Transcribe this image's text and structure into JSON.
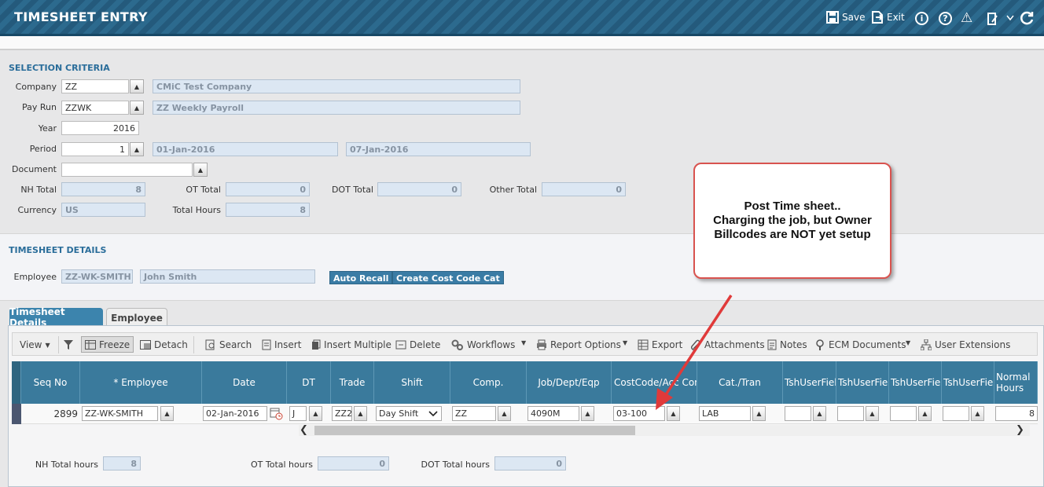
{
  "header": {
    "title": "TIMESHEET ENTRY",
    "save_label": "Save",
    "exit_label": "Exit",
    "info_icon": "i",
    "help_icon": "?",
    "warn_icon": "⚠"
  },
  "selection": {
    "title": "SELECTION CRITERIA",
    "company_label": "Company",
    "company_value": "ZZ",
    "company_name": "CMiC Test Company",
    "payrun_label": "Pay Run",
    "payrun_value": "ZZWK",
    "payrun_name": "ZZ Weekly Payroll",
    "year_label": "Year",
    "year_value": "2016",
    "period_label": "Period",
    "period_value": "1",
    "period_start": "01-Jan-2016",
    "period_end": "07-Jan-2016",
    "document_label": "Document",
    "document_value": "",
    "nh_total_label": "NH Total",
    "nh_total_value": "8",
    "ot_total_label": "OT Total",
    "ot_total_value": "0",
    "dot_total_label": "DOT Total",
    "dot_total_value": "0",
    "other_total_label": "Other Total",
    "other_total_value": "0",
    "currency_label": "Currency",
    "currency_value": "US",
    "total_hours_label": "Total Hours",
    "total_hours_value": "8"
  },
  "details": {
    "title": "TIMESHEET DETAILS",
    "employee_label": "Employee",
    "employee_code": "ZZ-WK-SMITH",
    "employee_name": "John Smith",
    "auto_recall_label": "Auto Recall",
    "create_cost_code_label": "Create Cost Code Cat"
  },
  "tabs": {
    "timesheet_details": "Timesheet Details",
    "employee": "Employee"
  },
  "toolbar": {
    "view": "View",
    "freeze": "Freeze",
    "detach": "Detach",
    "search": "Search",
    "insert": "Insert",
    "insert_multiple": "Insert Multiple",
    "delete": "Delete",
    "workflows": "Workflows",
    "report_options": "Report Options",
    "export": "Export",
    "attachments": "Attachments",
    "notes": "Notes",
    "ecm_documents": "ECM Documents",
    "user_extensions": "User Extensions"
  },
  "grid": {
    "headers": {
      "seq_no": "Seq No",
      "employee": "* Employee",
      "date": "Date",
      "dt": "DT",
      "trade": "Trade",
      "shift": "Shift",
      "comp": "Comp.",
      "job": "Job/Dept/Eqp",
      "costcode": "CostCode/Acc Comp",
      "cat": "Cat./Tran",
      "uf1": "TshUserField",
      "uf2": "TshUserField",
      "uf3": "TshUserField",
      "uf4": "TshUserField",
      "normal_hours": "Normal Hours"
    },
    "row": {
      "seq_no": "2899",
      "employee": "ZZ-WK-SMITH",
      "date": "02-Jan-2016",
      "dt": "J",
      "trade": "ZZ2",
      "shift": "Day Shift",
      "comp": "ZZ",
      "job": "4090M",
      "costcode": "03-100",
      "cat": "LAB",
      "uf1": "",
      "uf2": "",
      "uf3": "",
      "uf4": "",
      "normal_hours": "8"
    }
  },
  "footer": {
    "nh_label": "NH Total hours",
    "nh_value": "8",
    "ot_label": "OT Total hours",
    "ot_value": "0",
    "dot_label": "DOT Total hours",
    "dot_value": "0"
  },
  "callout": {
    "line1": "Post Time sheet..",
    "line2": "Charging the job, but Owner",
    "line3": "Billcodes are NOT yet setup"
  },
  "colors": {
    "header_bg": "#2c6a8e",
    "accent": "#3a7ca5",
    "callout_border": "#d9534f",
    "arrow": "#e03a3a"
  }
}
